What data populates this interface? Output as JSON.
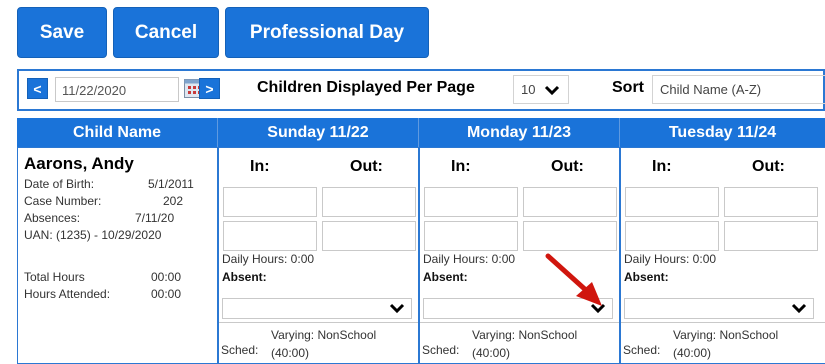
{
  "buttons": {
    "save": "Save",
    "cancel": "Cancel",
    "professional_day": "Professional Day"
  },
  "toolbar": {
    "prev": "<",
    "next": ">",
    "date_value": "11/22/2020",
    "per_page_label": "Children Displayed Per Page",
    "per_page_value": "10",
    "sort_label": "Sort",
    "sort_value": "Child Name (A-Z)"
  },
  "grid": {
    "child_header": "Child Name",
    "days": [
      {
        "header": "Sunday 11/22"
      },
      {
        "header": "Monday 11/23"
      },
      {
        "header": "Tuesday 11/24"
      }
    ],
    "in_label": "In:",
    "out_label": "Out:",
    "daily_hours": "Daily Hours: 0:00",
    "absent_label": "Absent:",
    "sched_label": "Sched:",
    "sched_value_line1": "Varying: NonSchool",
    "sched_value_line2": "(40:00)"
  },
  "child": {
    "name": "Aarons, Andy",
    "dob_label": "Date of Birth:",
    "dob_value": "5/1/2011",
    "case_label": "Case Number:",
    "case_value": "202",
    "absences_label": "Absences:",
    "absences_value": "7/11/20",
    "uan": "UAN: (1235) - 10/29/2020",
    "total_hours_label": "Total Hours",
    "total_hours_value": "00:00",
    "hours_attended_label": "Hours Attended:",
    "hours_attended_value": "00:00"
  },
  "colors": {
    "accent": "#1a73d9",
    "annotation_arrow": "#d0160e"
  },
  "icons": {
    "calendar": "calendar-icon",
    "chevron": "chevron-down-icon",
    "annotation": "red-arrow-icon"
  }
}
